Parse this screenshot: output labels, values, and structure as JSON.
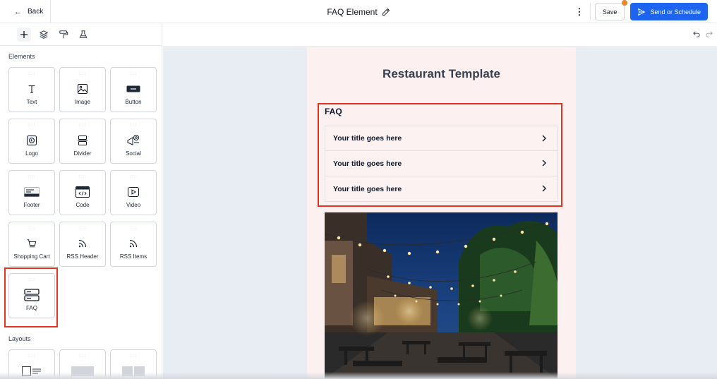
{
  "topbar": {
    "back_label": "Back",
    "title": "FAQ Element",
    "save_label": "Save",
    "send_label": "Send or Schedule"
  },
  "sidebar": {
    "tools": [
      "add-icon",
      "layers-icon",
      "paint-roller-icon",
      "flask-icon"
    ],
    "elements_title": "Elements",
    "elements": [
      {
        "label": "Text",
        "icon": "text-icon"
      },
      {
        "label": "Image",
        "icon": "image-icon"
      },
      {
        "label": "Button",
        "icon": "button-icon"
      },
      {
        "label": "Logo",
        "icon": "logo-icon"
      },
      {
        "label": "Divider",
        "icon": "divider-icon"
      },
      {
        "label": "Social",
        "icon": "social-icon"
      },
      {
        "label": "Footer",
        "icon": "footer-icon"
      },
      {
        "label": "Code",
        "icon": "code-icon"
      },
      {
        "label": "Video",
        "icon": "video-icon"
      },
      {
        "label": "Shopping Cart",
        "icon": "cart-icon"
      },
      {
        "label": "RSS Header",
        "icon": "rss-icon"
      },
      {
        "label": "RSS Items",
        "icon": "rss-icon"
      },
      {
        "label": "FAQ",
        "icon": "faq-icon"
      }
    ],
    "layouts_title": "Layouts"
  },
  "email": {
    "title": "Restaurant Template",
    "faq_heading": "FAQ",
    "faq_items": [
      "Your title goes here",
      "Your title goes here",
      "Your title goes here"
    ]
  },
  "colors": {
    "primary": "#1d64f0",
    "highlight": "#e0321c",
    "notification_dot": "#e28a2c",
    "canvas_bg": "#e8ecf3",
    "email_bg": "#fdf0f0"
  }
}
